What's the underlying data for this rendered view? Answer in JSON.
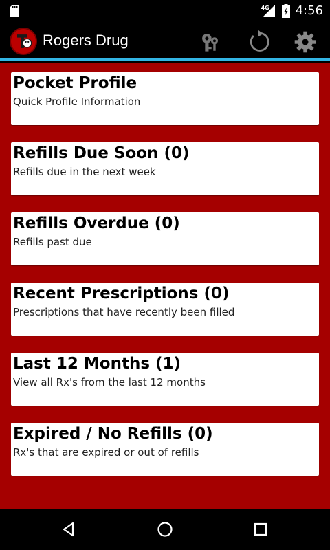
{
  "status_bar": {
    "network": "4G",
    "time": "4:56"
  },
  "action_bar": {
    "title": "Rogers Drug",
    "icons": [
      "logo-icon",
      "key-icon",
      "refresh-icon",
      "settings-icon"
    ]
  },
  "menu": {
    "items": [
      {
        "title": "Pocket Profile",
        "subtitle": "Quick Profile Information"
      },
      {
        "title": "Refills Due Soon (0)",
        "subtitle": "Refills due in the next week"
      },
      {
        "title": "Refills Overdue (0)",
        "subtitle": "Refills past due"
      },
      {
        "title": "Recent Prescriptions (0)",
        "subtitle": "Prescriptions that have recently been filled"
      },
      {
        "title": "Last 12 Months (1)",
        "subtitle": "View all Rx's from the last 12 months"
      },
      {
        "title": "Expired / No Refills (0)",
        "subtitle": "Rx's that are expired or out of refills"
      }
    ]
  },
  "nav_bar": {
    "icons": [
      "back-icon",
      "home-icon",
      "recents-icon"
    ]
  },
  "colors": {
    "background": "#a50000",
    "action_bar_divider": "#33b5e5",
    "card": "#ffffff"
  }
}
